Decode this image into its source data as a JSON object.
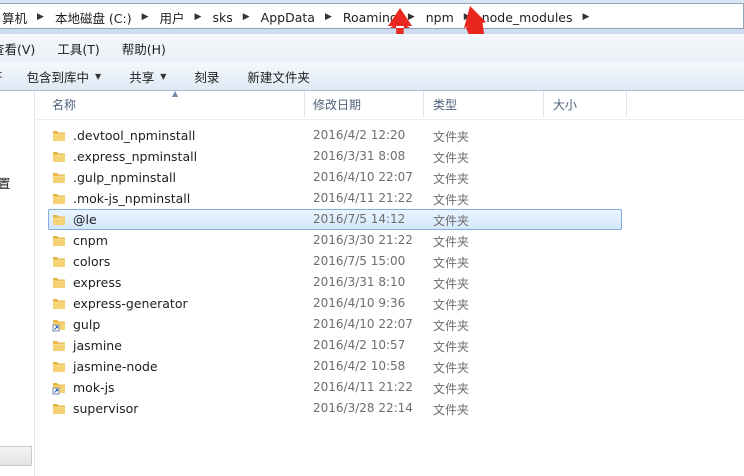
{
  "address_bar": {
    "crumbs": [
      "算机",
      "本地磁盘 (C:)",
      "用户",
      "sks",
      "AppData",
      "Roaming",
      "npm",
      "node_modules"
    ]
  },
  "menu": {
    "view": "查看(V)",
    "tools": "工具(T)",
    "help": "帮助(H)"
  },
  "toolbar": {
    "open": "开",
    "include_library": "包含到库中",
    "share": "共享",
    "burn": "刻录",
    "new_folder": "新建文件夹"
  },
  "nav_pane": {
    "partial_label": "置"
  },
  "columns": {
    "name": "名称",
    "modified": "修改日期",
    "type": "类型",
    "size": "大小"
  },
  "files": [
    {
      "name": ".devtool_npminstall",
      "date": "2016/4/2 12:20",
      "type": "文件夹",
      "icon": "folder-icon"
    },
    {
      "name": ".express_npminstall",
      "date": "2016/3/31 8:08",
      "type": "文件夹",
      "icon": "folder-icon"
    },
    {
      "name": ".gulp_npminstall",
      "date": "2016/4/10 22:07",
      "type": "文件夹",
      "icon": "folder-icon"
    },
    {
      "name": ".mok-js_npminstall",
      "date": "2016/4/11 21:22",
      "type": "文件夹",
      "icon": "folder-icon"
    },
    {
      "name": "@le",
      "date": "2016/7/5 14:12",
      "type": "文件夹",
      "icon": "folder-icon",
      "selected": true
    },
    {
      "name": "cnpm",
      "date": "2016/3/30 21:22",
      "type": "文件夹",
      "icon": "folder-icon"
    },
    {
      "name": "colors",
      "date": "2016/7/5 15:00",
      "type": "文件夹",
      "icon": "folder-icon"
    },
    {
      "name": "express",
      "date": "2016/3/31 8:10",
      "type": "文件夹",
      "icon": "folder-icon"
    },
    {
      "name": "express-generator",
      "date": "2016/4/10 9:36",
      "type": "文件夹",
      "icon": "folder-icon"
    },
    {
      "name": "gulp",
      "date": "2016/4/10 22:07",
      "type": "文件夹",
      "icon": "shortcut-folder-icon"
    },
    {
      "name": "jasmine",
      "date": "2016/4/2 10:57",
      "type": "文件夹",
      "icon": "folder-icon"
    },
    {
      "name": "jasmine-node",
      "date": "2016/4/2 10:58",
      "type": "文件夹",
      "icon": "folder-icon"
    },
    {
      "name": "mok-js",
      "date": "2016/4/11 21:22",
      "type": "文件夹",
      "icon": "shortcut-folder-icon"
    },
    {
      "name": "supervisor",
      "date": "2016/3/28 22:14",
      "type": "文件夹",
      "icon": "folder-icon"
    }
  ],
  "colors": {
    "annotation_arrow": "#e8271f",
    "selection_border": "#84acdd",
    "folder": "#f2c75c"
  }
}
